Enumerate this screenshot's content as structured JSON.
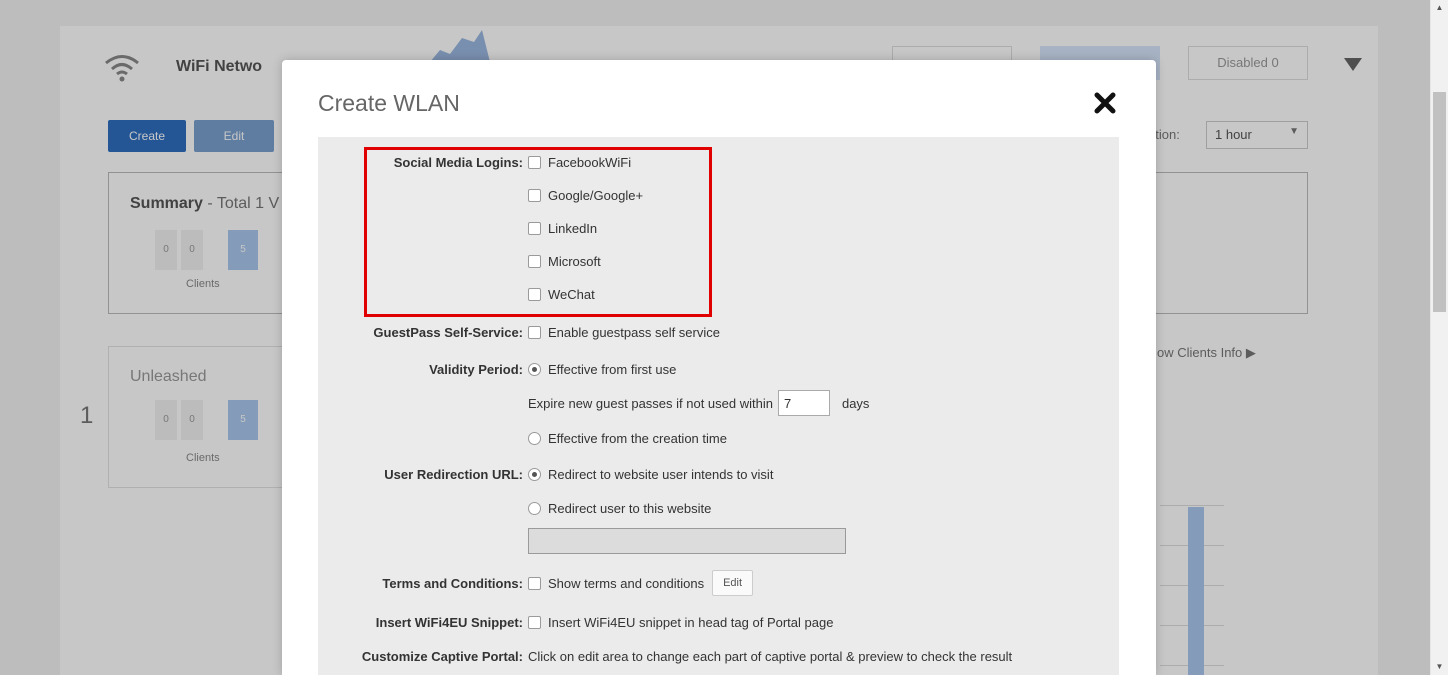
{
  "background": {
    "title": "WiFi Netwo",
    "segments": [
      "",
      "",
      "Disabled   0"
    ],
    "buttons": {
      "create": "Create",
      "edit": "Edit"
    },
    "duration_label": "ation:",
    "duration_value": "1 hour",
    "summary_card": {
      "title_bold": "Summary",
      "title_rest": " - Total 1 V",
      "counts": [
        "0",
        "0",
        "5"
      ],
      "clients_label": "Clients"
    },
    "unleashed_card": {
      "title": "Unleashed",
      "counts": [
        "0",
        "0",
        "5"
      ],
      "clients_label": "Clients",
      "index": "1"
    },
    "show_clients_info": "ow Clients Info"
  },
  "modal": {
    "title": "Create WLAN",
    "close_icon": "close-icon",
    "social_media": {
      "label": "Social Media Logins:",
      "options": [
        {
          "label": "FacebookWiFi",
          "checked": false
        },
        {
          "label": "Google/Google+",
          "checked": false
        },
        {
          "label": "LinkedIn",
          "checked": false
        },
        {
          "label": "Microsoft",
          "checked": false
        },
        {
          "label": "WeChat",
          "checked": false
        }
      ]
    },
    "guestpass": {
      "label": "GuestPass Self-Service:",
      "option": "Enable guestpass self service",
      "checked": false
    },
    "validity": {
      "label": "Validity Period:",
      "first_use": "Effective from first use",
      "expire_prefix": "Expire new guest passes if not used within",
      "expire_value": "7",
      "expire_suffix": "days",
      "creation_time": "Effective from the creation time",
      "selected": "first_use"
    },
    "redirection": {
      "label": "User Redirection URL:",
      "intended": "Redirect to website user intends to visit",
      "custom": "Redirect user to this website",
      "url_value": "",
      "selected": "intended"
    },
    "terms": {
      "label": "Terms and Conditions:",
      "option": "Show terms and conditions",
      "edit_label": "Edit",
      "checked": false
    },
    "wifi4eu": {
      "label": "Insert WiFi4EU Snippet:",
      "option": "Insert WiFi4EU snippet in head tag of Portal page",
      "checked": false
    },
    "captive_portal": {
      "label": "Customize Captive Portal:",
      "text": "Click on edit area to change each part of captive portal & preview to check the result"
    }
  },
  "colors": {
    "highlight": "#e00000",
    "accent": "#2f6fc0"
  }
}
